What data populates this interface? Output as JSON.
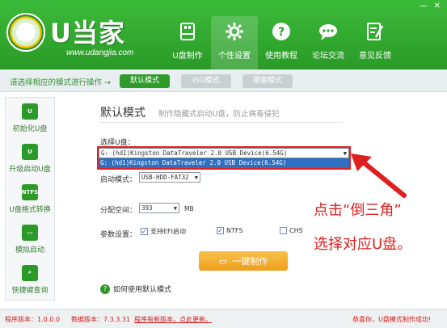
{
  "window": {
    "min_icon": "minimize-icon",
    "close_icon": "close-icon"
  },
  "brand": {
    "title": "U当家",
    "url": "www.udangjia.com"
  },
  "nav": [
    {
      "label": "U盘制作",
      "icon": "usb-icon"
    },
    {
      "label": "个性设置",
      "icon": "gear-icon"
    },
    {
      "label": "使用教程",
      "icon": "question-icon"
    },
    {
      "label": "论坛交流",
      "icon": "chat-icon"
    },
    {
      "label": "意见反馈",
      "icon": "feedback-icon"
    }
  ],
  "modebar": {
    "hint": "请选择相应的模式进行操作 →",
    "modes": [
      "默认模式",
      "ISO模式",
      "硬盘模式"
    ]
  },
  "sidebar": [
    {
      "label": "初始化U盘",
      "icon": "usb-init-icon",
      "glyph": "U"
    },
    {
      "label": "升级启动U盘",
      "icon": "usb-upgrade-icon",
      "glyph": "U"
    },
    {
      "label": "U盘格式转换",
      "icon": "ntfs-icon",
      "glyph": "NTFS"
    },
    {
      "label": "模拟启动",
      "icon": "monitor-icon",
      "glyph": "▭"
    },
    {
      "label": "快捷键查询",
      "icon": "search-icon",
      "glyph": "⌕"
    }
  ],
  "main": {
    "title": "默认模式",
    "subtitle": "制作隐藏式启动U盘，防止病毒侵犯",
    "select_label": "选择U盘：",
    "select_value": "G: (hd1)Kingston DataTraveler 2.0 USB Device(6.54G)",
    "select_option": "G: (hd1)Kingston DataTraveler 2.0 USB Device(6.54G)",
    "boot_label": "启动模式：",
    "boot_value": "USB-HDD-FAT32",
    "alloc_label": "分配空间：",
    "alloc_value": "393",
    "alloc_unit": "MB",
    "params_label": "参数设置：",
    "checks": [
      {
        "label": "支持EFI启动",
        "checked": true
      },
      {
        "label": "NTFS",
        "checked": true
      },
      {
        "label": "CHS",
        "checked": false
      }
    ],
    "build_label": "一键制作",
    "help_label": "如何使用默认模式"
  },
  "annotation": {
    "line1": "点击“倒三角”",
    "line2": "选择对应U盘。",
    "color": "#e02020"
  },
  "status": {
    "app_version": "程序版本：1.0.0.0",
    "data_version": "数据版本：7.3.3.31",
    "update": "程序有新版本，点此更新。",
    "congrats": "恭喜你，U盘模式制作成功!"
  }
}
